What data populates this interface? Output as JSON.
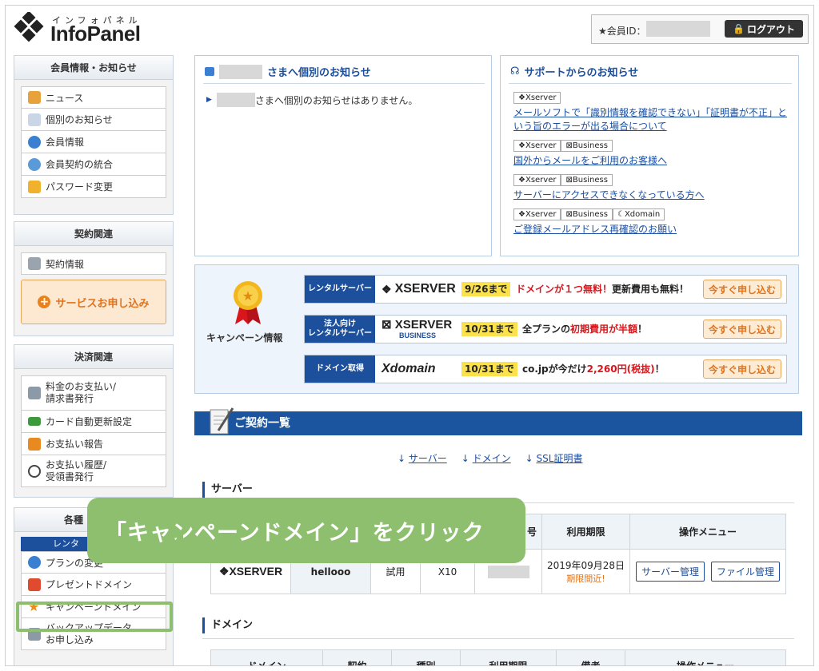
{
  "header": {
    "logo_kana": "インフォパネル",
    "logo_text": "InfoPanel",
    "member_id_label": "★会員ID：",
    "logout_label": "ログアウト"
  },
  "sidebar": {
    "panel1": {
      "title": "会員情報・お知らせ",
      "items": [
        {
          "label": "ニュース"
        },
        {
          "label": "個別のお知らせ"
        },
        {
          "label": "会員情報"
        },
        {
          "label": "会員契約の統合"
        },
        {
          "label": "パスワード変更"
        }
      ]
    },
    "panel2": {
      "title": "契約関連",
      "items": [
        {
          "label": "契約情報"
        }
      ],
      "service_button": "サービスお申し込み"
    },
    "panel3": {
      "title": "決済関連",
      "items": [
        {
          "label": "料金のお支払い/\n請求書発行"
        },
        {
          "label": "カード自動更新設定"
        },
        {
          "label": "お支払い報告"
        },
        {
          "label": "お支払い履歴/\n受領書発行"
        }
      ]
    },
    "panel4": {
      "title": "各種",
      "sub_bar": "レンタ",
      "items": [
        {
          "label": "プランの変更"
        },
        {
          "label": "プレゼントドメイン"
        },
        {
          "label": "キャンペーンドメイン"
        },
        {
          "label": "バックアップデータ\nお申し込み"
        }
      ]
    }
  },
  "notice_personal": {
    "title_suffix": "さまへ個別のお知らせ",
    "message_suffix": "さまへ個別のお知らせはありません。"
  },
  "notice_support": {
    "title": "サポートからのお知らせ",
    "items": [
      {
        "tags": [
          "Xserver"
        ],
        "link": "メールソフトで「識別情報を確認できない」「証明書が不正」という旨のエラーが出る場合について"
      },
      {
        "tags": [
          "Xserver",
          "Business"
        ],
        "link": "国外からメールをご利用のお客様へ"
      },
      {
        "tags": [
          "Xserver",
          "Business"
        ],
        "link": "サーバーにアクセスできなくなっている方へ"
      },
      {
        "tags": [
          "Xserver",
          "Business",
          "Xdomain"
        ],
        "link": "ご登録メールアドレス再確認のお願い"
      }
    ]
  },
  "campaign": {
    "label": "キャンペーン情報",
    "rows": [
      {
        "tag": "レンタルサーバー",
        "brand": "XSERVER",
        "date": "9/26まで",
        "text_red": "ドメインが１つ無料！",
        "text_black": "更新費用も無料！",
        "button": "今すぐ申し込む"
      },
      {
        "tag": "法人向け\nレンタルサーバー",
        "brand": "XSERVER",
        "brand_sub": "BUSINESS",
        "date": "10/31まで",
        "text_black": "全プランの",
        "text_red": "初期費用が半額",
        "text_tail": "！",
        "button": "今すぐ申し込む"
      },
      {
        "tag": "ドメイン取得",
        "brand": "Xdomain",
        "date": "10/31まで",
        "text_black": "co.jpが今だけ",
        "text_red": "2,260円(税抜)",
        "text_tail": "！",
        "button": "今すぐ申し込む"
      }
    ]
  },
  "contracts": {
    "title": "ご契約一覧",
    "anchors": [
      "サーバー",
      "ドメイン",
      "SSL証明書"
    ],
    "server_section": "サーバー",
    "server_table": {
      "headers": [
        "号",
        "利用期限",
        "操作メニュー"
      ],
      "row": {
        "brand": "XSERVER",
        "id": "hellooo",
        "type": "試用",
        "plan": "X10",
        "expiry": "2019年09月28日",
        "expiry_note": "期限間近!",
        "btn1": "サーバー管理",
        "btn2": "ファイル管理"
      }
    },
    "domain_section": "ドメイン",
    "domain_headers": [
      "ドメイン",
      "契約",
      "種別",
      "利用期限",
      "備考",
      "操作メニュー"
    ]
  },
  "callout": {
    "text": "「キャンペーンドメイン」をクリック"
  },
  "colors": {
    "accent": "#1c4f9c",
    "callout": "#8ebf6f",
    "orange": "#e0731c",
    "red": "#d9161c",
    "yellow": "#fbe24c"
  }
}
